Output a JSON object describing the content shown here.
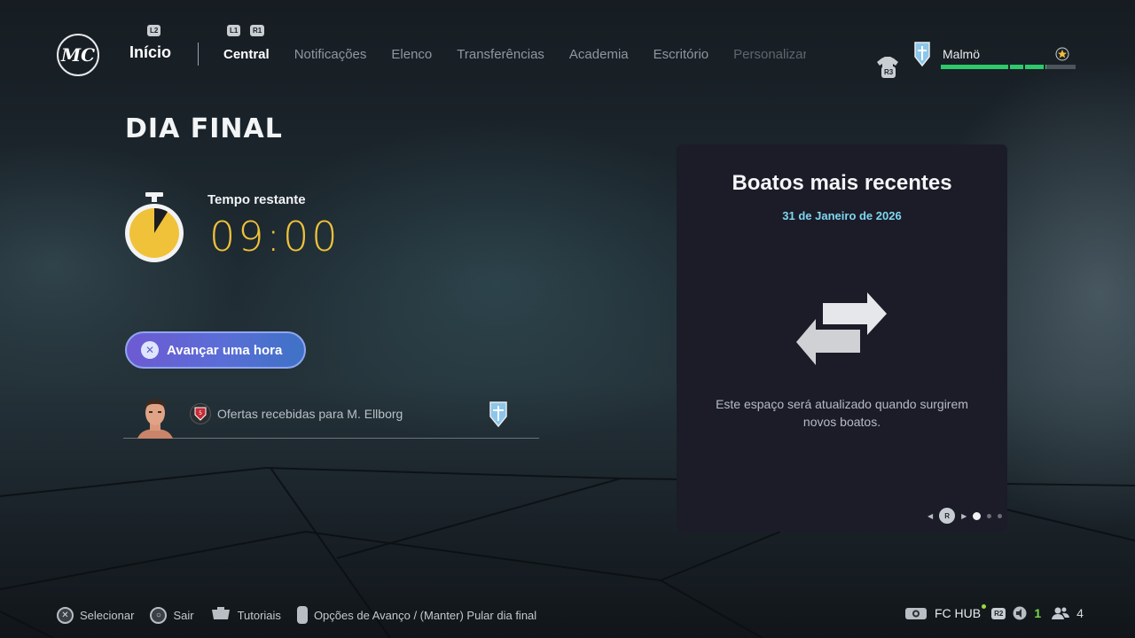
{
  "nav": {
    "logo_text": "MC",
    "l2_hint": "L2",
    "l1_hint": "L1",
    "r1_hint": "R1",
    "home_label": "Início",
    "tabs": [
      {
        "label": "Central",
        "active": true
      },
      {
        "label": "Notificações",
        "active": false
      },
      {
        "label": "Elenco",
        "active": false
      },
      {
        "label": "Transferências",
        "active": false
      },
      {
        "label": "Academia",
        "active": false
      },
      {
        "label": "Escritório",
        "active": false
      },
      {
        "label": "Personalizar",
        "active": false
      }
    ]
  },
  "club": {
    "name": "Malmö",
    "r3_hint": "R3",
    "progress_fraction": 0.78,
    "bar_color": "#2ec96b",
    "star_icon": "star-badge-icon"
  },
  "main": {
    "title": "DIA FINAL",
    "timer_label": "Tempo restante",
    "timer_value": "09:00",
    "timer_color": "#f0c23a",
    "advance_button": "Avançar uma hora",
    "offer_text": "Ofertas recebidas para M. Ellborg"
  },
  "rumors": {
    "title": "Boatos mais recentes",
    "date": "31 de Janeiro de 2026",
    "message": "Este espaço será atualizado quando surgirem novos boatos.",
    "pager_button": "R",
    "pages": 3,
    "active_page": 1
  },
  "footer": {
    "select_label": "Selecionar",
    "exit_label": "Sair",
    "tutorials_label": "Tutoriais",
    "advance_options_label": "Opções de Avanço / (Manter) Pular dia final",
    "hub_label": "FC HUB",
    "r2_hint": "R2",
    "notifications_count": "1",
    "players_count": "4"
  }
}
